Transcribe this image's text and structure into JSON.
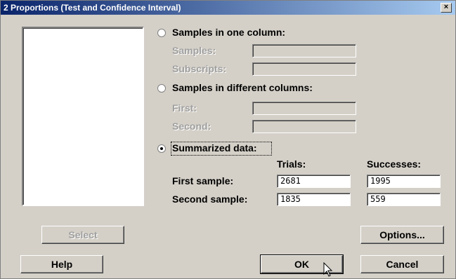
{
  "window": {
    "title": "2 Proportions (Test and Confidence Interval)",
    "close_label": "×"
  },
  "options": {
    "one_column": {
      "label": "Samples in one column:",
      "samples_label": "Samples:",
      "subscripts_label": "Subscripts:",
      "samples_value": "",
      "subscripts_value": ""
    },
    "different_columns": {
      "label": "Samples in different columns:",
      "first_label": "First:",
      "second_label": "Second:",
      "first_value": "",
      "second_value": ""
    },
    "summarized": {
      "label": "Summarized data:",
      "selected": true,
      "trials_header": "Trials:",
      "successes_header": "Successes:",
      "first_sample_label": "First sample:",
      "second_sample_label": "Second sample:",
      "first_trials": "2681",
      "first_successes": "1995",
      "second_trials": "1835",
      "second_successes": "559"
    }
  },
  "buttons": {
    "select": "Select",
    "options": "Options...",
    "help": "Help",
    "ok": "OK",
    "cancel": "Cancel"
  }
}
